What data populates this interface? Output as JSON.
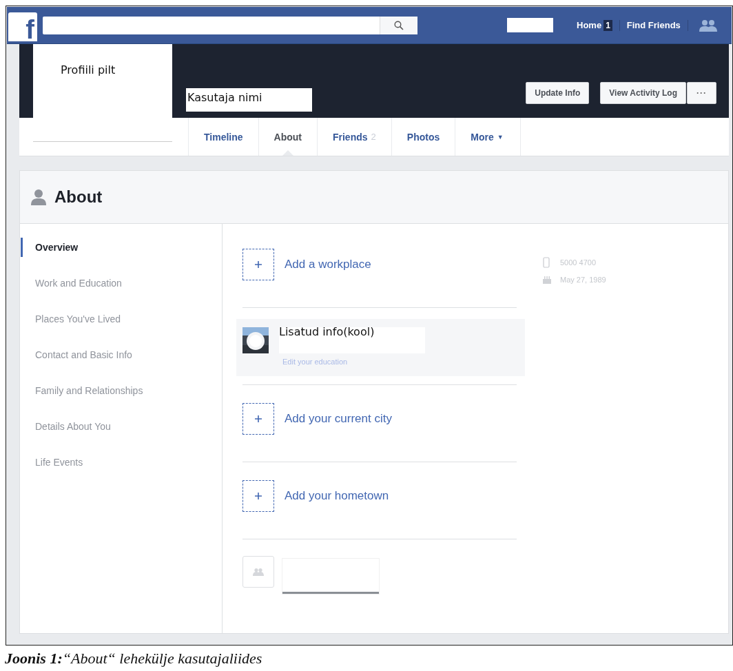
{
  "top_bar": {
    "logo": "f",
    "nav_links": [
      {
        "label": "Home",
        "badge": "1"
      },
      {
        "label": "Find Friends"
      }
    ]
  },
  "profile": {
    "picture_label": "Profiili pilt",
    "name": "Kasutaja nimi",
    "buttons": [
      {
        "kind": "text",
        "label": "Update Info"
      },
      {
        "kind": "text",
        "label": "View Activity Log"
      },
      {
        "kind": "more",
        "label": "···"
      }
    ]
  },
  "tabs": [
    {
      "label": "Timeline",
      "selected": false
    },
    {
      "label": "About",
      "selected": true
    },
    {
      "label": "Friends",
      "count": "2",
      "selected": false
    },
    {
      "label": "Photos",
      "selected": false
    },
    {
      "label": "More",
      "caret": "▼",
      "selected": false
    }
  ],
  "about": {
    "title": "About",
    "sections": [
      {
        "label": "Overview",
        "selected": true
      },
      {
        "label": "Work and Education",
        "selected": false
      },
      {
        "label": "Places You've Lived",
        "selected": false
      },
      {
        "label": "Contact and Basic Info",
        "selected": false
      },
      {
        "label": "Family and Relationships",
        "selected": false
      },
      {
        "label": "Details About You",
        "selected": false
      },
      {
        "label": "Life Events",
        "selected": false
      }
    ],
    "entries": [
      {
        "kind": "add",
        "label": "Add a workplace"
      },
      {
        "kind": "education",
        "title": "Lisatud info(kool)",
        "link": "Edit your education"
      },
      {
        "kind": "add",
        "label": "Add your current city"
      },
      {
        "kind": "add",
        "label": "Add your hometown"
      },
      {
        "kind": "redacted"
      }
    ],
    "details": [
      {
        "kind": "phone",
        "text": "5000 4700"
      },
      {
        "kind": "birthday",
        "text": "May 27, 1989"
      }
    ]
  },
  "caption": "**Joonis 1:**“About“ lehekülje kasutajaliides"
}
